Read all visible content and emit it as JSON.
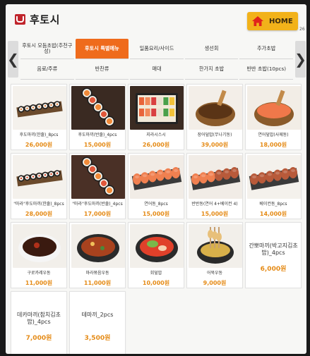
{
  "header": {
    "brand": "후토시",
    "home_label": "HOME",
    "page_no": "26"
  },
  "nav": {
    "prev_glyph": "❮",
    "next_glyph": "❯",
    "categories": [
      {
        "label": "후토시 모듬초밥(추천구성)",
        "active": false
      },
      {
        "label": "후토시 특별메뉴",
        "active": true
      },
      {
        "label": "일품요리/사이드",
        "active": false
      },
      {
        "label": "생선회",
        "active": false
      },
      {
        "label": "추가초밥",
        "active": false
      },
      {
        "label": "음료/주류",
        "active": false
      },
      {
        "label": "반찬류",
        "active": false
      },
      {
        "label": "매대",
        "active": false
      },
      {
        "label": "한가지 초밥",
        "active": false
      },
      {
        "label": "반반 초밥(10pcs)",
        "active": false
      }
    ]
  },
  "products": [
    {
      "name": "후도마끼(한줄)_8pcs",
      "price": "26,000원",
      "photo": "sushi-roll-board"
    },
    {
      "name": "후도마끼(반줄)_4pcs",
      "price": "15,000원",
      "photo": "sushi-roll-stack"
    },
    {
      "name": "지라시스시",
      "price": "26,000원",
      "photo": "chirashi-box"
    },
    {
      "name": "장어덮밥(무나기동)",
      "price": "39,000원",
      "photo": "eel-rice-bowl"
    },
    {
      "name": "연어덮밥(사께동)",
      "price": "18,000원",
      "photo": "salmon-rice-bowl"
    },
    {
      "name": "\"마라\"후도마끼(한줄)_8pcs",
      "price": "28,000원",
      "photo": "mala-roll-board"
    },
    {
      "name": "\"마라\"후도마끼(반줄)_4pcs",
      "price": "17,000원",
      "photo": "mala-roll-half"
    },
    {
      "name": "연어동_8pcs",
      "price": "15,000원",
      "photo": "salmon-nigiri"
    },
    {
      "name": "반반동(연어 4+베이컨 4)",
      "price": "15,000원",
      "photo": "half-half-nigiri"
    },
    {
      "name": "베이컨동_8pcs",
      "price": "14,000원",
      "photo": "bacon-nigiri"
    },
    {
      "name": "구로카레우동",
      "price": "11,000원",
      "photo": "black-curry-udon"
    },
    {
      "name": "마라볶음우동",
      "price": "11,000원",
      "photo": "mala-stirfry-udon"
    },
    {
      "name": "회덮밥",
      "price": "10,000원",
      "photo": "sashimi-rice"
    },
    {
      "name": "어묵우동",
      "price": "9,000원",
      "photo": "fishcake-udon"
    },
    {
      "name": "간뽀마끼(박고지김초밥)_4pcs",
      "price": "6,000원",
      "photo": ""
    },
    {
      "name": "데카마끼(참치김초밥)_4pcs",
      "price": "7,000원",
      "photo": ""
    },
    {
      "name": "테마끼_2pcs",
      "price": "3,500원",
      "photo": ""
    }
  ],
  "colors": {
    "accent": "#ef6b1c",
    "home": "#f2b21a",
    "price": "#e58b17",
    "brand": "#c0252c"
  }
}
